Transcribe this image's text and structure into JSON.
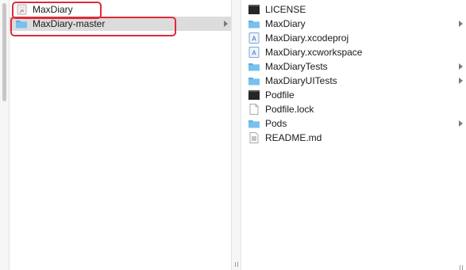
{
  "left_column": {
    "items": [
      {
        "label": "MaxDiary",
        "icon": "app-icon",
        "selected": false,
        "has_children": false
      },
      {
        "label": "MaxDiary-master",
        "icon": "folder-icon",
        "selected": true,
        "has_children": true
      }
    ]
  },
  "right_column": {
    "items": [
      {
        "label": "LICENSE",
        "icon": "terminal-file-icon",
        "has_children": false
      },
      {
        "label": "MaxDiary",
        "icon": "folder-icon",
        "has_children": true
      },
      {
        "label": "MaxDiary.xcodeproj",
        "icon": "xcode-project-icon",
        "has_children": false
      },
      {
        "label": "MaxDiary.xcworkspace",
        "icon": "xcode-workspace-icon",
        "has_children": false
      },
      {
        "label": "MaxDiaryTests",
        "icon": "folder-icon",
        "has_children": true
      },
      {
        "label": "MaxDiaryUITests",
        "icon": "folder-icon",
        "has_children": true
      },
      {
        "label": "Podfile",
        "icon": "terminal-file-icon",
        "has_children": false
      },
      {
        "label": "Podfile.lock",
        "icon": "document-icon",
        "has_children": false
      },
      {
        "label": "Pods",
        "icon": "folder-icon",
        "has_children": true
      },
      {
        "label": "README.md",
        "icon": "text-document-icon",
        "has_children": false
      }
    ]
  },
  "colors": {
    "folder": "#5aaee3",
    "selection": "#dcdcdc",
    "highlight": "#e02a3a"
  }
}
